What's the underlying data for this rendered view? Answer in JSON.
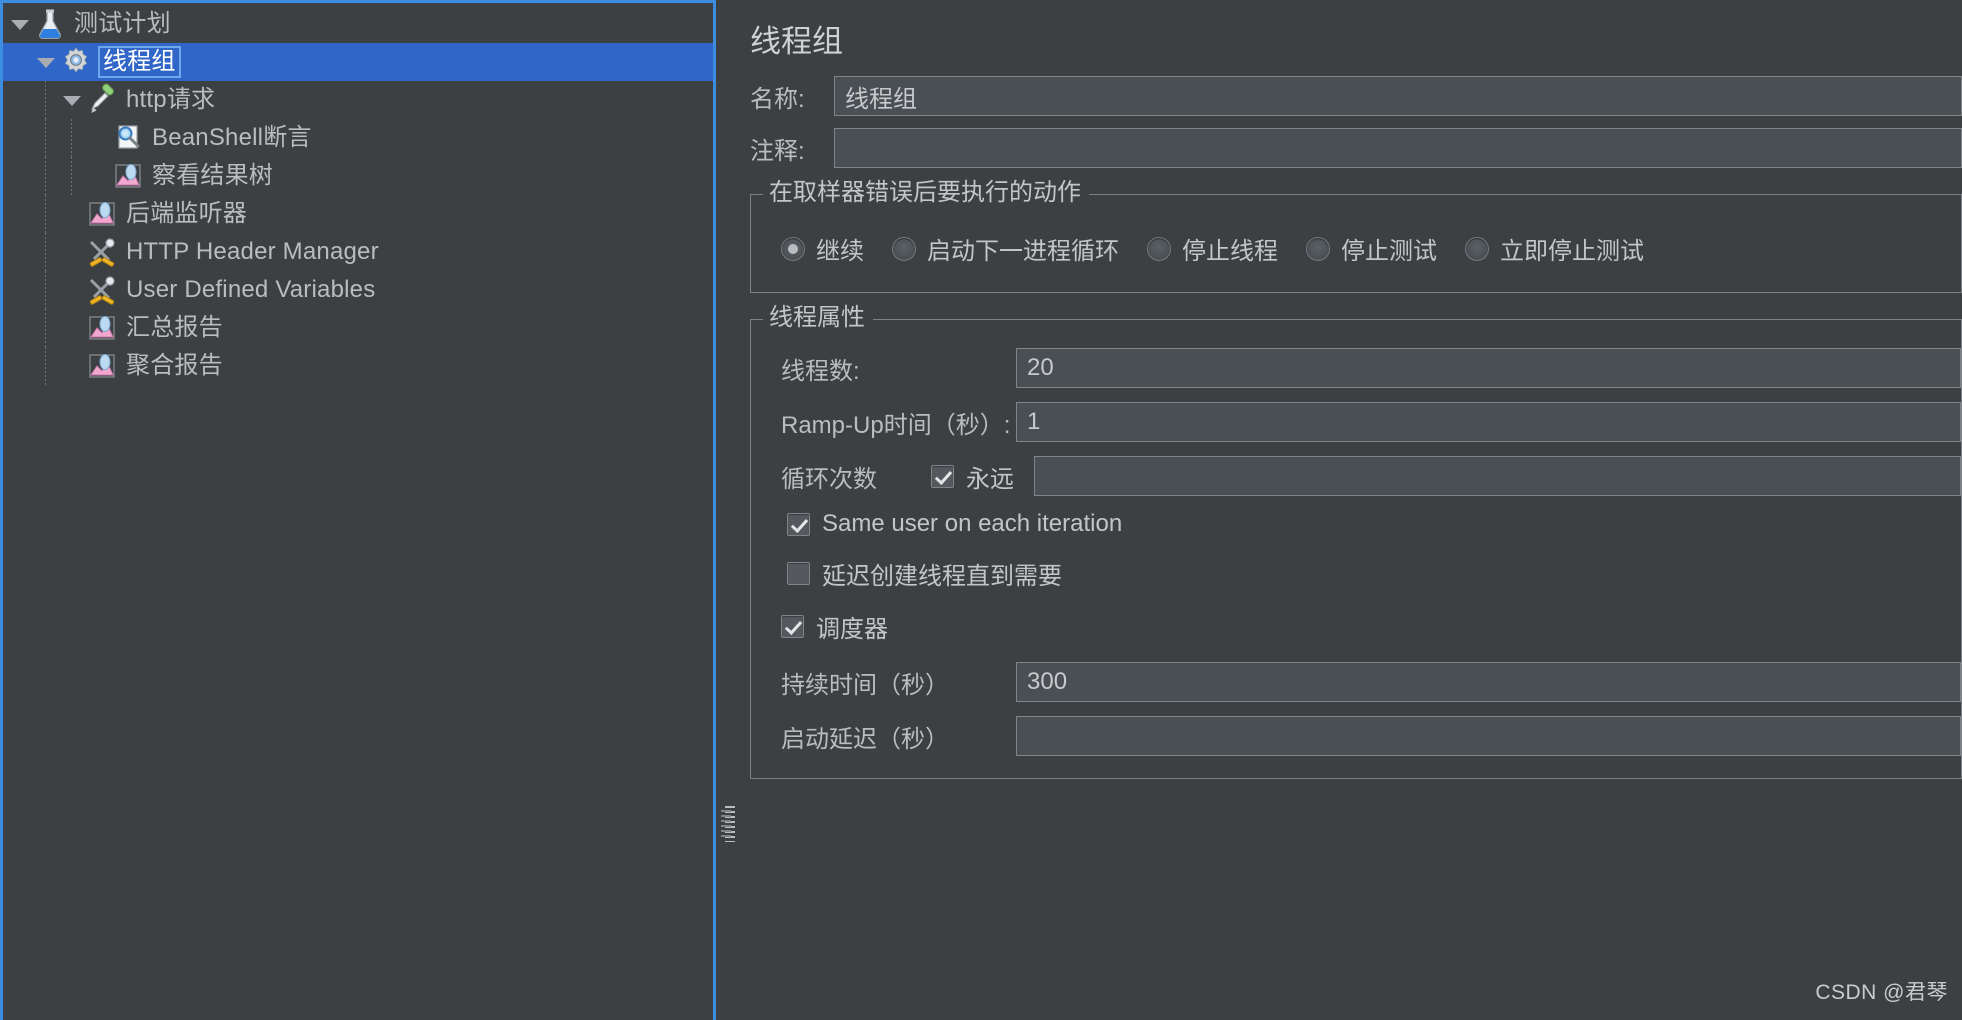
{
  "tree": {
    "items": [
      {
        "label": "测试计划",
        "icon": "flask-icon",
        "depth": 0,
        "twisty": "open",
        "selected": false
      },
      {
        "label": "线程组",
        "icon": "gear-icon",
        "depth": 1,
        "twisty": "open",
        "selected": true
      },
      {
        "label": "http请求",
        "icon": "pipette-icon",
        "depth": 2,
        "twisty": "open",
        "selected": false
      },
      {
        "label": "BeanShell断言",
        "icon": "magnifier-page-icon",
        "depth": 3,
        "twisty": "none",
        "selected": false
      },
      {
        "label": "察看结果树",
        "icon": "chart-icon",
        "depth": 3,
        "twisty": "none",
        "selected": false
      },
      {
        "label": "后端监听器",
        "icon": "chart-icon",
        "depth": 2,
        "twisty": "none",
        "selected": false
      },
      {
        "label": "HTTP Header Manager",
        "icon": "tools-icon",
        "depth": 2,
        "twisty": "none",
        "selected": false
      },
      {
        "label": "User Defined Variables",
        "icon": "tools-icon",
        "depth": 2,
        "twisty": "none",
        "selected": false
      },
      {
        "label": "汇总报告",
        "icon": "chart-icon",
        "depth": 2,
        "twisty": "none",
        "selected": false
      },
      {
        "label": "聚合报告",
        "icon": "chart-icon",
        "depth": 2,
        "twisty": "none",
        "selected": false
      }
    ]
  },
  "panel": {
    "title": "线程组",
    "name_label": "名称:",
    "name_value": "线程组",
    "comment_label": "注释:",
    "comment_value": "",
    "error_action": {
      "title": "在取样器错误后要执行的动作",
      "options": [
        {
          "label": "继续",
          "selected": true
        },
        {
          "label": "启动下一进程循环",
          "selected": false
        },
        {
          "label": "停止线程",
          "selected": false
        },
        {
          "label": "停止测试",
          "selected": false
        },
        {
          "label": "立即停止测试",
          "selected": false
        }
      ]
    },
    "thread_properties": {
      "title": "线程属性",
      "num_threads_label": "线程数:",
      "num_threads_value": "20",
      "ramp_up_label": "Ramp-Up时间（秒）:",
      "ramp_up_value": "1",
      "loop_count_label": "循环次数",
      "forever_label": "永远",
      "forever_checked": true,
      "loop_count_value": "",
      "same_user_label": "Same user on each iteration",
      "same_user_checked": true,
      "delay_thread_label": "延迟创建线程直到需要",
      "delay_thread_checked": false,
      "scheduler_label": "调度器",
      "scheduler_checked": true,
      "duration_label": "持续时间（秒）",
      "duration_value": "300",
      "startup_delay_label": "启动延迟（秒）",
      "startup_delay_value": ""
    }
  },
  "watermark": "CSDN @君琴",
  "colors": {
    "background": "#3c4043",
    "selection": "#2f66c8",
    "panel_border": "#3c8ce0",
    "text": "#b9bdc0",
    "field_bg": "#4a4f53"
  }
}
